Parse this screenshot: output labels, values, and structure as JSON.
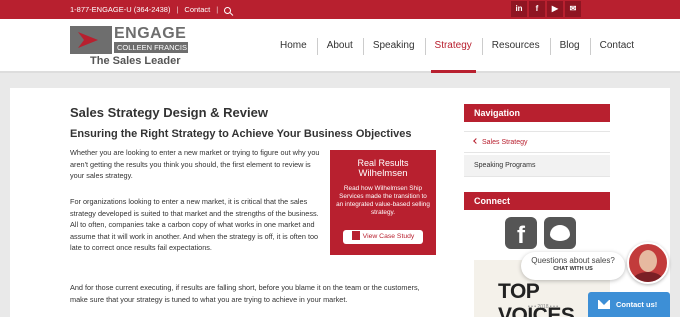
{
  "topbar": {
    "phone": "1-877-ENGAGE-U (364-2438)",
    "contact": "Contact",
    "social": [
      "in",
      "f",
      "▶",
      "✉"
    ]
  },
  "logo": {
    "engage": "ENGAGE",
    "name": "COLLEEN FRANCIS",
    "tagline": "The Sales Leader"
  },
  "nav": {
    "items": [
      "Home",
      "About",
      "Speaking",
      "Strategy",
      "Resources",
      "Blog",
      "Contact"
    ],
    "active": "Strategy"
  },
  "page": {
    "title": "Sales Strategy Design & Review",
    "subtitle": "Ensuring the Right Strategy to Achieve Your Business Objectives",
    "p1": "Whether you are looking to enter a new market or trying to figure out why you aren't getting the results you think you should, the first element to review is your sales strategy.",
    "p2": "For organizations looking to enter a new market, it is critical that the sales strategy developed is suited to that market and the strengths of the business. All to often, companies take a carbon copy of what works in one market and assume that it will work in another. And when the strategy is off, it is often too late to correct once results fail expectations.",
    "p3": "And for those current executing, if results are falling short, before you blame it on the team or the customers, make sure that your strategy is tuned to what you are trying to achieve in your market."
  },
  "case_study": {
    "heading": "Real Results",
    "company": "Wilhelmsen",
    "description": "Read how Wilhelmsen Ship Services made the transition to an integrated value-based selling strategy.",
    "button": "View Case Study"
  },
  "sidebar": {
    "navigation_title": "Navigation",
    "links": [
      "Sales Strategy",
      "Speaking Programs"
    ],
    "connect_title": "Connect",
    "top_voices": "TOP VOICES",
    "top_voices_year": "• • • 2018 • • •"
  },
  "chat": {
    "question": "Questions about sales?",
    "cta": "CHAT WITH US",
    "contact_button": "Contact us!"
  }
}
